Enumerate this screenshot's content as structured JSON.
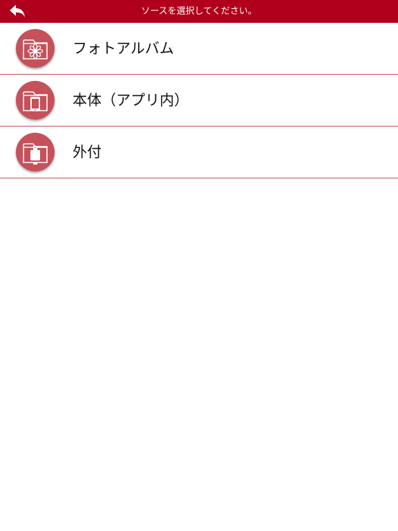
{
  "header": {
    "title": "ソースを選択してください。",
    "back_icon": "reply-arrow-icon",
    "bg_color": "#b0001b"
  },
  "sources": [
    {
      "label": "フォトアルバム",
      "icon": "photo-album-folder-icon"
    },
    {
      "label": "本体（アプリ内）",
      "icon": "device-folder-icon"
    },
    {
      "label": "外付",
      "icon": "external-storage-folder-icon"
    }
  ],
  "colors": {
    "accent": "#b0001b",
    "icon_circle": "#c5515b",
    "divider": "#c8495a"
  }
}
